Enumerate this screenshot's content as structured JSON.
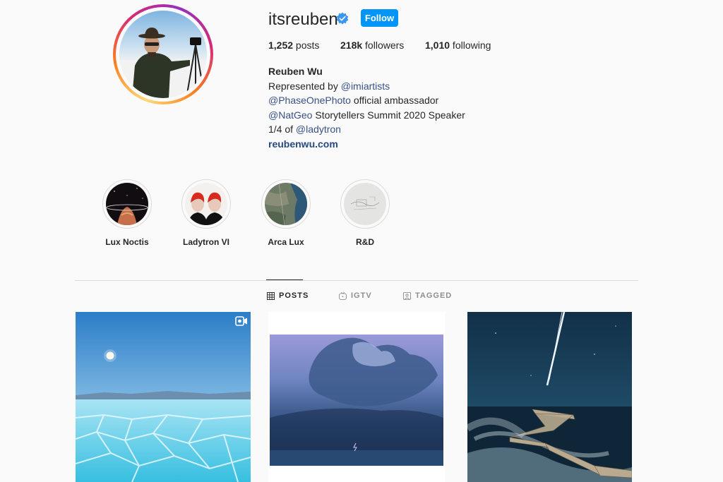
{
  "profile": {
    "username": "itsreuben",
    "verified": true,
    "follow_label": "Follow",
    "stats": {
      "posts_count": "1,252",
      "posts_label": " posts",
      "followers_count": "218k",
      "followers_label": " followers",
      "following_count": "1,010",
      "following_label": " following"
    },
    "bio": {
      "name": "Reuben Wu",
      "line1_prefix": "Represented by ",
      "line1_link": "@imiartists",
      "line2_link": "@PhaseOnePhoto",
      "line2_suffix": " official ambassador",
      "line3_link": "@NatGeo",
      "line3_suffix": " Storytellers Summit 2020 Speaker",
      "line4_prefix": "1/4 of ",
      "line4_link": "@ladytron",
      "website": "reubenwu.com"
    }
  },
  "highlights": [
    {
      "label": "Lux Noctis"
    },
    {
      "label": "Ladytron VI"
    },
    {
      "label": "Arca Lux"
    },
    {
      "label": "R&D"
    }
  ],
  "tabs": [
    {
      "label": "POSTS",
      "icon": "grid-icon",
      "active": true
    },
    {
      "label": "IGTV",
      "icon": "igtv-icon",
      "active": false
    },
    {
      "label": "TAGGED",
      "icon": "tagged-icon",
      "active": false
    }
  ],
  "colors": {
    "follow_button": "#0095f6",
    "link": "#385185",
    "background": "#fafafa"
  }
}
